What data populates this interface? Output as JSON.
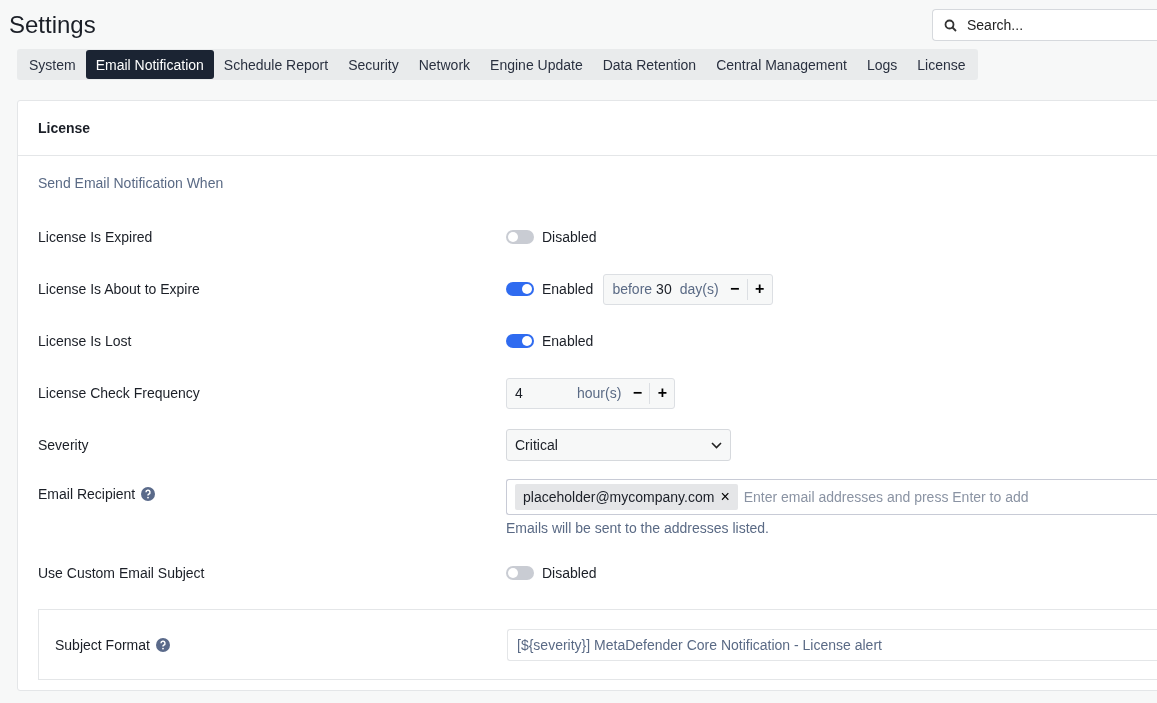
{
  "title": "Settings",
  "search": {
    "placeholder": "Search..."
  },
  "tabs": [
    {
      "label": "System",
      "selected": false
    },
    {
      "label": "Email Notification",
      "selected": true
    },
    {
      "label": "Schedule Report",
      "selected": false
    },
    {
      "label": "Security",
      "selected": false
    },
    {
      "label": "Network",
      "selected": false
    },
    {
      "label": "Engine Update",
      "selected": false
    },
    {
      "label": "Data Retention",
      "selected": false
    },
    {
      "label": "Central Management",
      "selected": false
    },
    {
      "label": "Logs",
      "selected": false
    },
    {
      "label": "License",
      "selected": false
    }
  ],
  "panel": {
    "heading": "License",
    "section": "Send Email Notification When",
    "rows": [
      {
        "kind": "toggle",
        "label": "License Is Expired",
        "on": false,
        "state": "Disabled"
      },
      {
        "kind": "toggle",
        "label": "License Is About to Expire",
        "on": true,
        "state": "Enabled",
        "stepper": {
          "prefix": "before",
          "value": "30",
          "unit": "day(s)",
          "minus": "−",
          "plus": "+"
        }
      },
      {
        "kind": "toggle",
        "label": "License Is Lost",
        "on": true,
        "state": "Enabled"
      },
      {
        "kind": "stepper",
        "label": "License Check Frequency",
        "stepper": {
          "value": "4",
          "unit": "hour(s)",
          "minus": "−",
          "plus": "+"
        }
      },
      {
        "kind": "select",
        "label": "Severity",
        "value": "Critical"
      },
      {
        "kind": "tags",
        "label": "Email Recipient",
        "help": true,
        "tags": [
          {
            "text": "placeholder@mycompany.com",
            "remove": "×"
          }
        ],
        "placeholder": "Enter email addresses and press Enter to add",
        "hint": "Emails will be sent to the addresses listed."
      },
      {
        "kind": "toggle",
        "label": "Use Custom Email Subject",
        "on": false,
        "state": "Disabled"
      },
      {
        "kind": "subject",
        "label": "Subject Format",
        "help": true,
        "value": "[${severity}] MetaDefender Core Notification - License alert"
      }
    ]
  }
}
